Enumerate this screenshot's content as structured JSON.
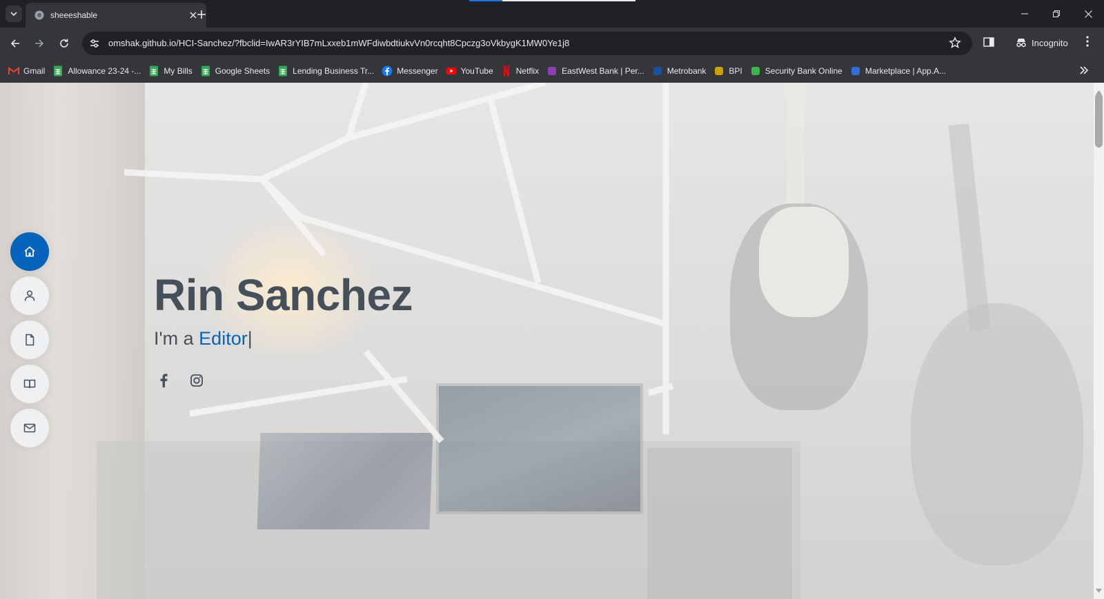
{
  "browser": {
    "tab": {
      "title": "sheeeshable",
      "close_label": "×"
    },
    "new_tab_label": "+",
    "loading_progress": 0.2,
    "url": {
      "host": "omshak.github.io",
      "path": "/HCI-Sanchez/?fbclid=IwAR3rYIB7mLxxeb1mWFdiwbdtiukvVn0rcqht8Cpczg3oVkbygK1MW0Ye1j8"
    },
    "incognito_label": "Incognito",
    "icons": {
      "tab_search": "chevron-down-icon",
      "back": "arrow-left-icon",
      "forward": "arrow-right-icon",
      "reload": "reload-icon",
      "site_info": "tune-icon",
      "bookmark_star": "star-icon",
      "side_panel": "side-panel-icon",
      "menu": "kebab-menu-icon"
    }
  },
  "bookmarks": [
    {
      "label": "Gmail",
      "icon": "gmail-icon",
      "color": "#ea4335"
    },
    {
      "label": "Allowance 23-24 -...",
      "icon": "sheets-icon",
      "color": "#34a853"
    },
    {
      "label": "My Bills",
      "icon": "sheets-icon",
      "color": "#34a853"
    },
    {
      "label": "Google Sheets",
      "icon": "sheets-icon",
      "color": "#34a853"
    },
    {
      "label": "Lending Business Tr...",
      "icon": "sheets-icon",
      "color": "#34a853"
    },
    {
      "label": "Messenger",
      "icon": "facebook-icon",
      "color": "#1877f2"
    },
    {
      "label": "YouTube",
      "icon": "youtube-icon",
      "color": "#ff0000"
    },
    {
      "label": "Netflix",
      "icon": "netflix-icon",
      "color": "#e50914"
    },
    {
      "label": "EastWest Bank | Per...",
      "icon": "eastwest-icon",
      "color": "#8e3fb4"
    },
    {
      "label": "Metrobank",
      "icon": "metrobank-icon",
      "color": "#1b4fa0"
    },
    {
      "label": "BPI",
      "icon": "bpi-icon",
      "color": "#c8a000"
    },
    {
      "label": "Security Bank Online",
      "icon": "securitybank-icon",
      "color": "#3ab54a"
    },
    {
      "label": "Marketplace | App.A...",
      "icon": "marketplace-icon",
      "color": "#2f6fd6"
    }
  ],
  "side_nav": [
    {
      "name": "home",
      "icon": "home-icon",
      "active": true
    },
    {
      "name": "about",
      "icon": "person-icon",
      "active": false
    },
    {
      "name": "resume",
      "icon": "file-icon",
      "active": false
    },
    {
      "name": "portfolio",
      "icon": "book-icon",
      "active": false
    },
    {
      "name": "contact",
      "icon": "envelope-icon",
      "active": false
    }
  ],
  "hero": {
    "name": "Rin Sanchez",
    "tagline_prefix": "I'm a ",
    "typed_word": "Editor",
    "cursor": "|",
    "social": [
      {
        "name": "facebook",
        "icon": "facebook-icon"
      },
      {
        "name": "instagram",
        "icon": "instagram-icon"
      }
    ]
  },
  "colors": {
    "accent": "#0563bb",
    "text": "#45505b",
    "nav_bg": "#eef0f2"
  }
}
